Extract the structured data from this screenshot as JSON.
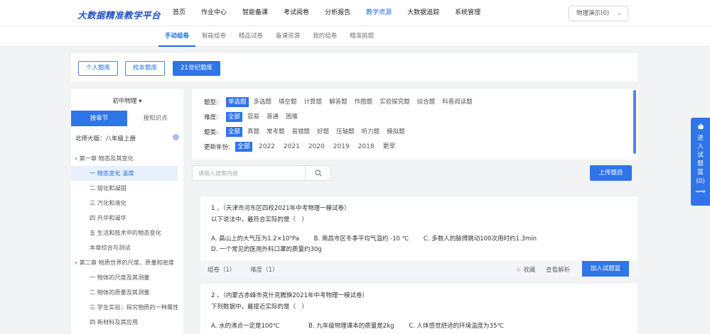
{
  "app": {
    "logo": "大数据精准教学平台"
  },
  "nav": {
    "items": [
      {
        "label": "首页",
        "active": false
      },
      {
        "label": "作业中心",
        "active": false
      },
      {
        "label": "智能备课",
        "active": false
      },
      {
        "label": "考试阅卷",
        "active": false
      },
      {
        "label": "分析报告",
        "active": false
      },
      {
        "label": "教学资源",
        "active": true
      },
      {
        "label": "大数据追踪",
        "active": false
      },
      {
        "label": "系统管理",
        "active": false
      }
    ],
    "user_dropdown": "物理演示(0)"
  },
  "subnav": {
    "items": [
      {
        "label": "手动组卷",
        "active": true
      },
      {
        "label": "智能组卷",
        "active": false
      },
      {
        "label": "精品试卷",
        "active": false
      },
      {
        "label": "备课资源",
        "active": false
      },
      {
        "label": "我的组卷",
        "active": false
      },
      {
        "label": "精准挑题",
        "active": false
      }
    ]
  },
  "libraries": [
    {
      "label": "个人题库",
      "active": false
    },
    {
      "label": "校本题库",
      "active": false
    },
    {
      "label": "21世纪题库",
      "active": true
    }
  ],
  "sidebar": {
    "grade": "初中物理",
    "tabs": [
      {
        "label": "按章节",
        "active": true
      },
      {
        "label": "按知识点",
        "active": false
      }
    ],
    "edition": "北师大版：八年级上册",
    "tree": [
      {
        "type": "ch",
        "label": "第一章 物态及其变化",
        "active": false
      },
      {
        "type": "sec",
        "label": "一 物态变化 温度",
        "active": true
      },
      {
        "type": "sec",
        "label": "二 熔化和凝固",
        "active": false
      },
      {
        "type": "sec",
        "label": "三 汽化和液化",
        "active": false
      },
      {
        "type": "sec",
        "label": "四 升华和凝华",
        "active": false
      },
      {
        "type": "sec",
        "label": "五 生活和技术中的物态变化",
        "active": false
      },
      {
        "type": "sec",
        "label": "本章综合与测试",
        "active": false
      },
      {
        "type": "ch",
        "label": "第二章 物质世界的尺度、质量和密度",
        "active": false
      },
      {
        "type": "sec",
        "label": "一 物体的尺度及其测量",
        "active": false
      },
      {
        "type": "sec",
        "label": "二 物体的质量及其测量",
        "active": false
      },
      {
        "type": "sec",
        "label": "三 学生实验：探究物质的一种属性",
        "active": false
      },
      {
        "type": "sec",
        "label": "四 新材料及其应用",
        "active": false
      }
    ]
  },
  "filters": {
    "type": {
      "label": "题型:",
      "options": [
        {
          "label": "单选题",
          "active": true
        },
        {
          "label": "多选题",
          "active": false
        },
        {
          "label": "填空题",
          "active": false
        },
        {
          "label": "计算题",
          "active": false
        },
        {
          "label": "解答题",
          "active": false
        },
        {
          "label": "作图题",
          "active": false
        },
        {
          "label": "实验探究题",
          "active": false
        },
        {
          "label": "综合题",
          "active": false
        },
        {
          "label": "科普阅读题",
          "active": false
        }
      ]
    },
    "difficulty": {
      "label": "难度:",
      "options": [
        {
          "label": "全部",
          "active": true
        },
        {
          "label": "容易",
          "active": false
        },
        {
          "label": "普通",
          "active": false
        },
        {
          "label": "困难",
          "active": false
        }
      ]
    },
    "category": {
      "label": "题类:",
      "options": [
        {
          "label": "全部",
          "active": true
        },
        {
          "label": "真题",
          "active": false
        },
        {
          "label": "常考题",
          "active": false
        },
        {
          "label": "易错题",
          "active": false
        },
        {
          "label": "好题",
          "active": false
        },
        {
          "label": "压轴题",
          "active": false
        },
        {
          "label": "听力题",
          "active": false
        },
        {
          "label": "模拟题",
          "active": false
        }
      ]
    },
    "year": {
      "label": "更新年份:",
      "options": [
        {
          "label": "全部",
          "active": true
        },
        {
          "label": "2022",
          "active": false
        },
        {
          "label": "2021",
          "active": false
        },
        {
          "label": "2020",
          "active": false
        },
        {
          "label": "2019",
          "active": false
        },
        {
          "label": "2018",
          "active": false
        },
        {
          "label": "更早",
          "active": false
        }
      ]
    }
  },
  "search": {
    "placeholder": "请输入搜索内容"
  },
  "upload_label": "上传题目",
  "questions": [
    {
      "head": "1 、（天津市河东区四校2021年中考物理一模试卷）",
      "stem": "以下说法中，最符合实际的是（　）",
      "options": [
        "A. 高山上的大气压为1.2×10⁵Pa",
        "B. 南昌市区冬季平均气温约 -10 ℃",
        "C. 多数人的脉搏跳动100次用时约1.3min",
        "D. 一个常见的医用外科口罩的质量约30g"
      ],
      "group_count": "组卷（1）",
      "difficulty": "难度（1）",
      "fav": "☆ 收藏",
      "analysis": "查看解析",
      "add": "加入试题篮"
    },
    {
      "head": "2 、（内蒙古赤峰市克什克腾旗2021年中考物理一模试卷）",
      "stem": "下列数据中，最接近实际的是（　）",
      "options": [
        "A. 水的沸点一定是100℃",
        "B. 九年级物理课本的质量是2kg",
        "C. 人体感觉舒适的环境温度为35℃"
      ]
    }
  ],
  "floattab": {
    "text": "进入试题篮",
    "count": "(0)",
    "arrow": "⟹"
  }
}
